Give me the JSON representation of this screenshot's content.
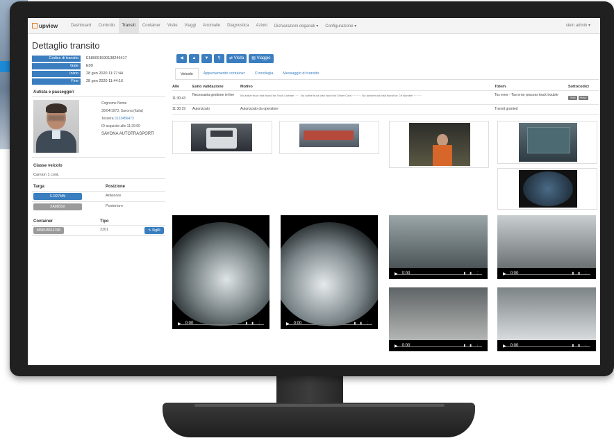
{
  "nav": {
    "logo": "upview",
    "items": [
      "Dashboard",
      "Controllo",
      "Transiti",
      "Container",
      "Visite",
      "Viaggi",
      "Anomalie",
      "Diagnostica",
      "Azioni",
      "Dichiarazioni doganali ▾",
      "Configurazione ▾"
    ],
    "active_index": 2,
    "user": "stein admin ▾"
  },
  "page": {
    "title": "Dettaglio transito"
  },
  "meta": [
    {
      "label": "Codice di transito",
      "value": "E580091590138246417"
    },
    {
      "label": "Gate",
      "value": "E09"
    },
    {
      "label": "Inizio",
      "value": "28 gen 2020 11:27:44"
    },
    {
      "label": "Fine",
      "value": "28 gen 2020 11:44:16"
    }
  ],
  "driver": {
    "section_title": "Autista e passeggeri",
    "name": "Cognome Nome",
    "birth": "30/04/1973, Savona (Italia)",
    "tessera_label": "Tessera",
    "tessera_value": "0123456473",
    "acquired": "ID acquisito alle 11:29:00",
    "company": "SAVONA AUTOTRASPORTI"
  },
  "vehicle": {
    "section_title": "Classe veicolo",
    "class": "Camion 1 cont."
  },
  "plates": {
    "col_targa": "Targa",
    "col_posizione": "Posizione",
    "rows": [
      {
        "plate": "CJ327MM",
        "position": "Anteriore",
        "style": "blue"
      },
      {
        "plate": "XA890SX",
        "position": "Posteriore",
        "style": "gray"
      }
    ]
  },
  "container": {
    "col_container": "Container",
    "col_tipo": "Tipo",
    "id": "MSKU5514768",
    "type": "2201",
    "button": "✎ Sigilli"
  },
  "toolbar": {
    "visita": "⇄ Visita",
    "viaggio": "▤ Viaggio"
  },
  "tabs": [
    "Veicolo",
    "Appuntamento container",
    "Cronologia",
    "Messaggio di transito"
  ],
  "events": {
    "headers": [
      "Alle",
      "Esito validazione",
      "Motivo",
      "Totem",
      "Sottocodici"
    ],
    "rows": [
      {
        "time": "11:30:43",
        "esito": "Necessaria gestione in-line",
        "motivo": "No active truck visit found for Truck License ·····. No active truck visit found for Driver Card ·········. No active truck visit found for Ctr Number ·········",
        "totem": "Tos error - Tos error process truck trouble",
        "codes": [
          "TRMI",
          "PMNV"
        ]
      },
      {
        "time": "11:30:19",
        "esito": "Autorizzato",
        "motivo": "Autorizzato da operatore",
        "totem": "Transit granted",
        "codes": []
      }
    ]
  },
  "videos": [
    {
      "time": "0:00"
    },
    {
      "time": "0:00"
    },
    {
      "time": "0:00"
    },
    {
      "time": "0:00"
    },
    {
      "time": "0:00"
    },
    {
      "time": "0:00"
    }
  ],
  "colors": {
    "primary": "#3a7ebf",
    "logo_accent": "#e07a1f"
  }
}
